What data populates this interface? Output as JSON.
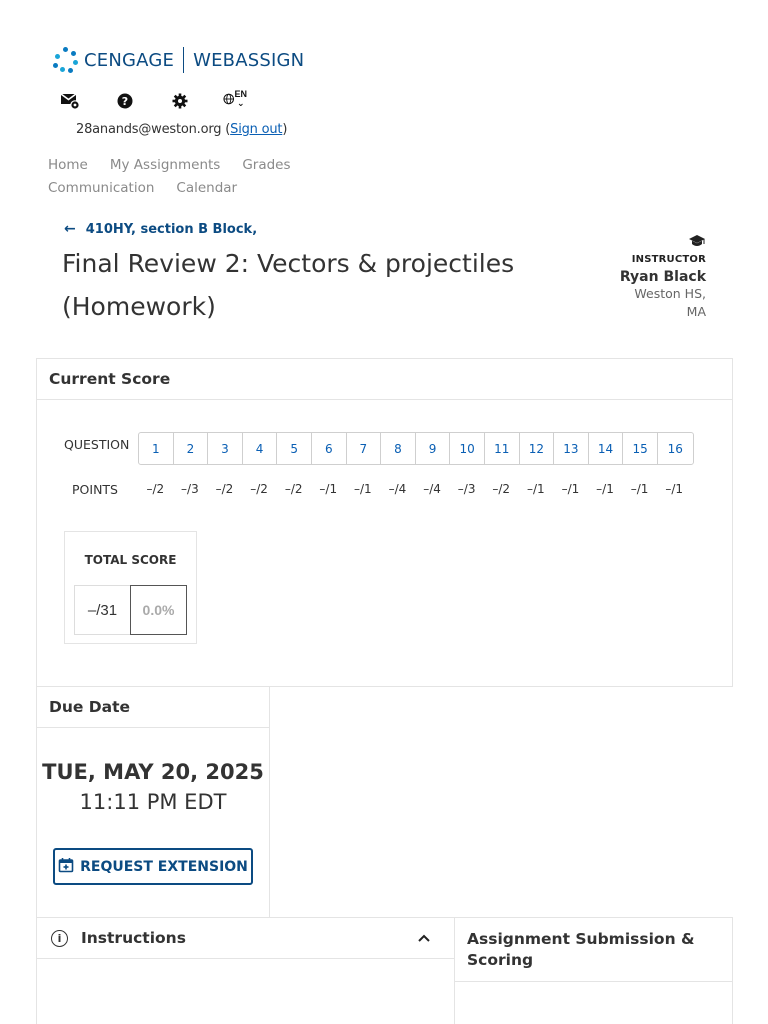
{
  "brand": {
    "left": "CENGAGE",
    "right": "WEBASSIGN",
    "color": "#0c4b82"
  },
  "toolbar": {
    "icons": [
      "messages-icon",
      "help-icon",
      "settings-icon",
      "globe-icon"
    ],
    "lang_code": "EN"
  },
  "user": {
    "email": "28anands@weston.org",
    "open_paren": "(",
    "sign_out": "Sign out",
    "close_paren": ")"
  },
  "nav": {
    "items": [
      "Home",
      "My Assignments",
      "Grades",
      "Communication",
      "Calendar"
    ]
  },
  "assignment": {
    "back_label": "410HY, section B Block,",
    "title": "Final Review 2: Vectors & projectiles (Homework)"
  },
  "instructor": {
    "role": "INSTRUCTOR",
    "name": "Ryan Black",
    "school": "Weston HS, MA"
  },
  "current_score": {
    "heading": "Current Score",
    "question_label": "QUESTION",
    "points_label": "POINTS",
    "questions": [
      "1",
      "2",
      "3",
      "4",
      "5",
      "6",
      "7",
      "8",
      "9",
      "10",
      "11",
      "12",
      "13",
      "14",
      "15",
      "16"
    ],
    "points": [
      "–/2",
      "–/3",
      "–/2",
      "–/2",
      "–/2",
      "–/1",
      "–/1",
      "–/4",
      "–/4",
      "–/3",
      "–/2",
      "–/1",
      "–/1",
      "–/1",
      "–/1",
      "–/1"
    ],
    "total_label": "TOTAL SCORE",
    "total_points": "–/31",
    "total_percent": "0.0%"
  },
  "due": {
    "heading": "Due Date",
    "date": "TUE, MAY 20, 2025",
    "time": "11:11 PM EDT",
    "extension_label": "REQUEST EXTENSION"
  },
  "instructions": {
    "heading": "Instructions"
  },
  "submission": {
    "heading": "Assignment Submission & Scoring"
  }
}
